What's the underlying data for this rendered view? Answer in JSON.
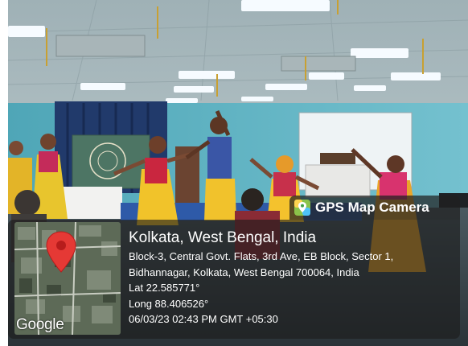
{
  "gps_badge": {
    "label": "GPS Map Camera",
    "icon": "camera-map-icon"
  },
  "location": {
    "place": "Kolkata, West Bengal, India",
    "address_line_1": "Block-3, Central Govt. Flats, 3rd Ave, EB Block, Sector 1,",
    "address_line_2": "Bidhannagar, Kolkata, West Bengal 700064, India",
    "latitude": "Lat 22.585771°",
    "longitude": "Long 88.406526°",
    "datetime": "06/03/23 02:43 PM GMT +05:30"
  },
  "map": {
    "provider_logo": "Google",
    "marker_icon": "map-pin-icon",
    "marker_color": "#e53935"
  },
  "colors": {
    "overlay": "#1c1c1c",
    "text": "#ffffff"
  }
}
